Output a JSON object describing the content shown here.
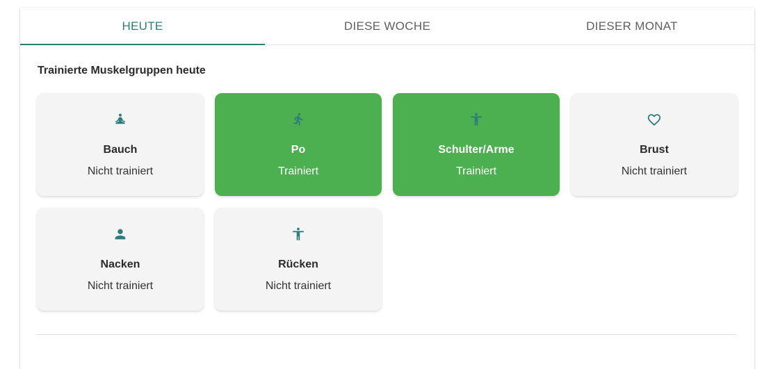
{
  "tabs": [
    {
      "label": "HEUTE",
      "active": true
    },
    {
      "label": "DIESE WOCHE",
      "active": false
    },
    {
      "label": "DIESER MONAT",
      "active": false
    }
  ],
  "section_title": "Trainierte Muskelgruppen heute",
  "colors": {
    "accent": "#2e7d7a",
    "trained": "#4caf50",
    "untrained": "#f4f4f4"
  },
  "muscle_groups": [
    {
      "name": "Bauch",
      "status": "Nicht trainiert",
      "trained": false,
      "icon": "meditation-icon"
    },
    {
      "name": "Po",
      "status": "Trainiert",
      "trained": true,
      "icon": "walking-person-icon"
    },
    {
      "name": "Schulter/Arme",
      "status": "Trainiert",
      "trained": true,
      "icon": "accessibility-person-icon"
    },
    {
      "name": "Brust",
      "status": "Nicht trainiert",
      "trained": false,
      "icon": "heart-outline-icon"
    },
    {
      "name": "Nacken",
      "status": "Nicht trainiert",
      "trained": false,
      "icon": "person-icon"
    },
    {
      "name": "Rücken",
      "status": "Nicht trainiert",
      "trained": false,
      "icon": "accessibility-person-icon"
    }
  ]
}
